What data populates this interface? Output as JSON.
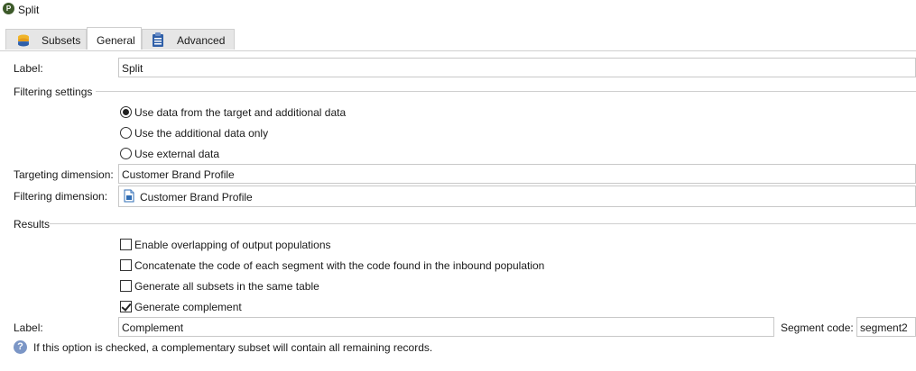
{
  "window": {
    "title": "Split"
  },
  "tabs": [
    {
      "label": "Subsets"
    },
    {
      "label": "General"
    },
    {
      "label": "Advanced"
    }
  ],
  "general": {
    "label_caption": "Label:",
    "label_value": "Split",
    "filtering_settings_title": "Filtering settings",
    "filtering_options": [
      {
        "label": "Use data from the target and additional data",
        "selected": true
      },
      {
        "label": "Use the additional data only",
        "selected": false
      },
      {
        "label": "Use external data",
        "selected": false
      }
    ],
    "targeting_dimension_caption": "Targeting dimension:",
    "targeting_dimension_value": "Customer Brand Profile",
    "filtering_dimension_caption": "Filtering dimension:",
    "filtering_dimension_value": "Customer Brand Profile",
    "results_title": "Results",
    "result_options": [
      {
        "label": "Enable overlapping of output populations",
        "checked": false
      },
      {
        "label": "Concatenate the code of each segment with the code found in the inbound population",
        "checked": false
      },
      {
        "label": "Generate all subsets in the same table",
        "checked": false
      },
      {
        "label": "Generate complement",
        "checked": true
      }
    ],
    "complement_label_caption": "Label:",
    "complement_label_value": "Complement",
    "segment_code_caption": "Segment code:",
    "segment_code_value": "segment2",
    "help_text": "If this option is checked, a complementary subset will contain all remaining records."
  },
  "colors": {
    "accent": "#2f6db5",
    "border": "#c8c8c8"
  }
}
